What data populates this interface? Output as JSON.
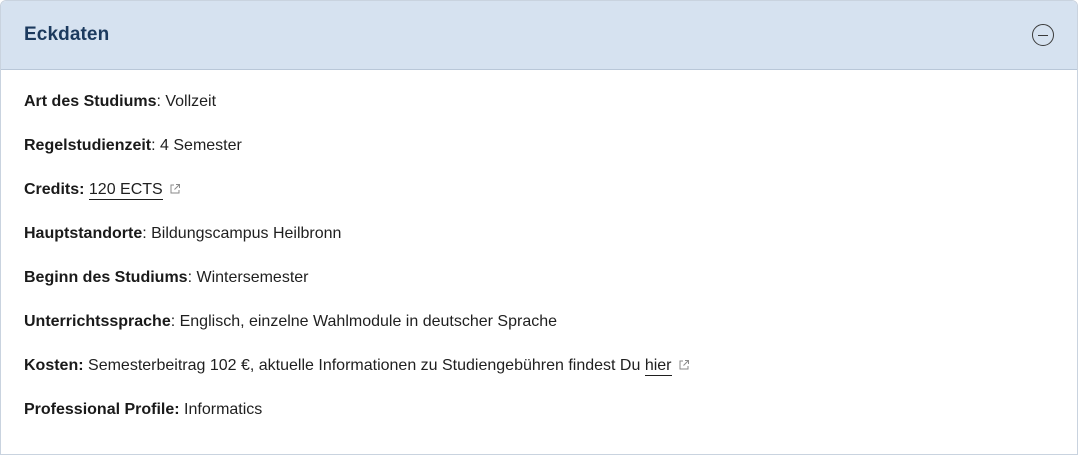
{
  "panel": {
    "title": "Eckdaten",
    "collapse_icon": "minus-circle-icon"
  },
  "rows": [
    {
      "label": "Art des Studiums",
      "sep": ": ",
      "value": "Vollzeit"
    },
    {
      "label": "Regelstudienzeit",
      "sep": ": ",
      "value": "4 Semester"
    },
    {
      "label": "Credits:",
      "sep": " ",
      "link": "120 ECTS",
      "link_icon": "external-link-icon"
    },
    {
      "label": "Hauptstandorte",
      "sep": ": ",
      "value": "Bildungscampus Heilbronn"
    },
    {
      "label": "Beginn des Studiums",
      "sep": ": ",
      "value": "Wintersemester"
    },
    {
      "label": "Unterrichtssprache",
      "sep": ": ",
      "value": "Englisch, einzelne Wahlmodule in deutscher Sprache"
    },
    {
      "label": "Kosten:",
      "sep": " ",
      "value": "Semesterbeitrag 102 €, aktuelle Informationen zu Studiengebühren findest Du ",
      "link": "hier",
      "link_icon": "external-link-icon"
    },
    {
      "label": "Professional Profile:",
      "sep": " ",
      "value": "Informatics"
    }
  ]
}
